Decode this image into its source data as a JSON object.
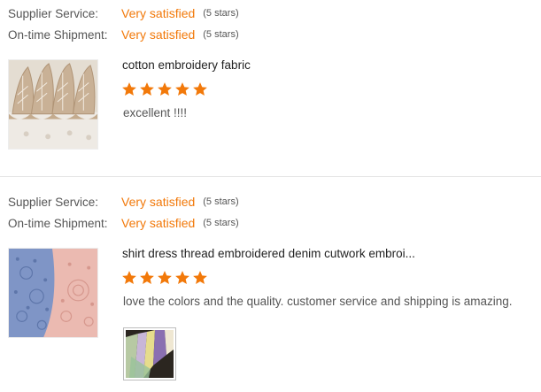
{
  "reviews": [
    {
      "ratings": [
        {
          "label": "Supplier Service:",
          "value": "Very satisfied",
          "stars": "(5 stars)"
        },
        {
          "label": "On-time Shipment:",
          "value": "Very satisfied",
          "stars": "(5 stars)"
        }
      ],
      "product_title": "cotton embroidery fabric",
      "star_rating": 5,
      "comment": "excellent !!!!",
      "star_color": "#f2790a"
    },
    {
      "ratings": [
        {
          "label": "Supplier Service:",
          "value": "Very satisfied",
          "stars": "(5 stars)"
        },
        {
          "label": "On-time Shipment:",
          "value": "Very satisfied",
          "stars": "(5 stars)"
        }
      ],
      "product_title": "shirt dress thread embroidered denim cutwork embroi...",
      "star_rating": 5,
      "comment": "love the colors and the quality. customer service and shipping is amazing.",
      "star_color": "#f2790a"
    }
  ]
}
